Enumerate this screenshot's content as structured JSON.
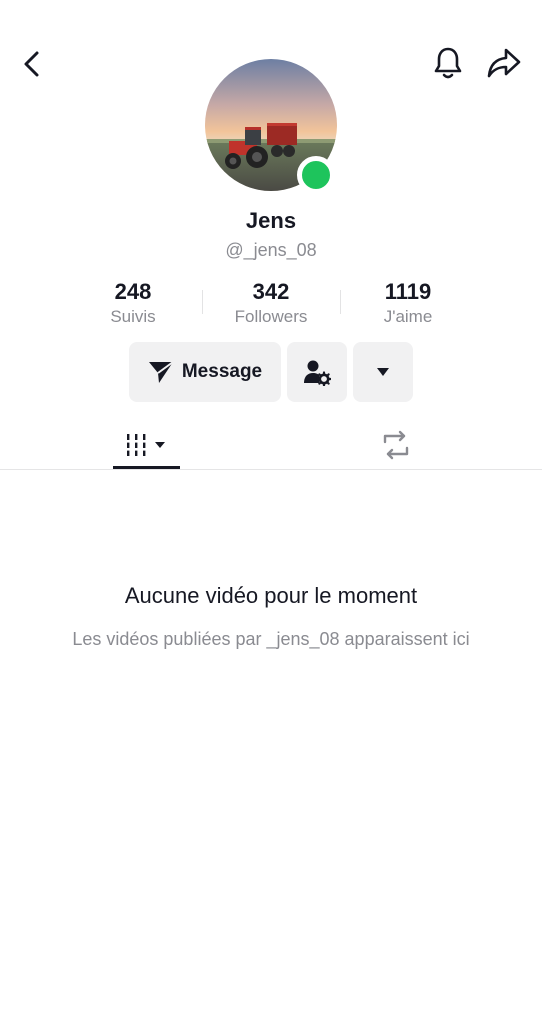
{
  "header": {
    "back_icon": "chevron-left-icon",
    "notifications_icon": "bell-icon",
    "share_icon": "share-arrow-icon"
  },
  "profile": {
    "display_name": "Jens",
    "username": "@_jens_08",
    "avatar": "tractor-in-field-photo",
    "online": true,
    "online_color": "#1ec45c"
  },
  "stats": [
    {
      "value": "248",
      "label": "Suivis"
    },
    {
      "value": "342",
      "label": "Followers"
    },
    {
      "value": "1119",
      "label": "J'aime"
    }
  ],
  "actions": {
    "message_label": "Message",
    "message_icon": "send-icon",
    "add_friend_icon": "user-settings-icon",
    "more_icon": "caret-down-icon"
  },
  "tabs": {
    "videos_icon": "grid-bars-icon",
    "reposts_icon": "repost-icon",
    "active": "videos"
  },
  "empty_state": {
    "title": "Aucune vidéo pour le moment",
    "subtitle": "Les vidéos publiées par _jens_08 apparaissent ici"
  },
  "colors": {
    "text": "#161823",
    "secondary": "#8a8b91",
    "button_bg": "#f1f1f2"
  }
}
